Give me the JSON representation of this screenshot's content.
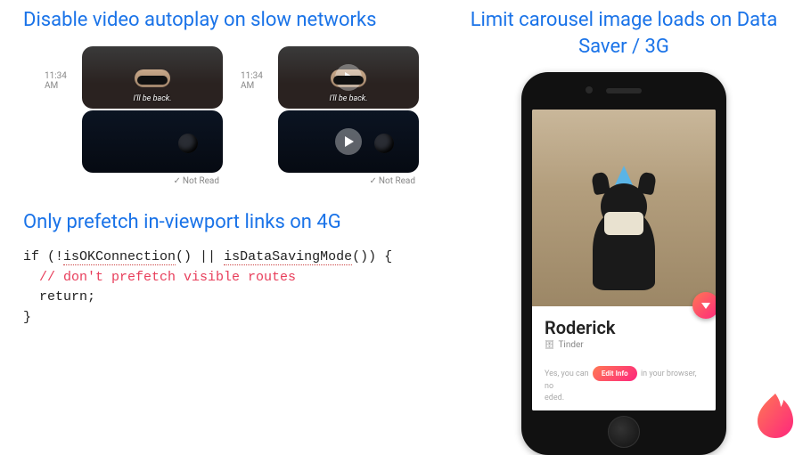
{
  "left": {
    "heading1": "Disable video autoplay on slow networks",
    "timestamp": "11:34 AM",
    "caption": "I'll be back.",
    "not_read": "Not Read",
    "heading2": "Only prefetch in-viewport links on 4G",
    "code": {
      "line1a": "if (!",
      "fn1": "isOKConnection",
      "line1b": "() || ",
      "fn2": "isDataSavingMode",
      "line1c": "()) {",
      "comment": "  // don't prefetch visible routes",
      "line3": "  return;",
      "line4": "}"
    }
  },
  "right": {
    "heading": "Limit carousel image loads on Data Saver / 3G",
    "profile_name": "Roderick",
    "profile_sub": "Tinder",
    "msg_a": "Yes, you can",
    "edit_info": "Edit Info",
    "msg_b": "in your browser, no",
    "msg_c": "eded."
  }
}
